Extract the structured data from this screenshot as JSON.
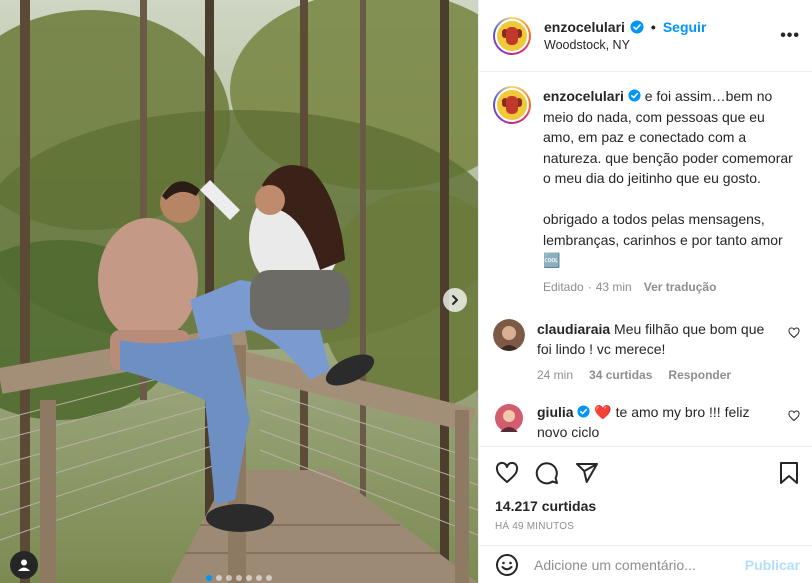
{
  "post": {
    "username": "enzocelulari",
    "follow_label": "Seguir",
    "location": "Woodstock, NY",
    "more_label": "•••"
  },
  "caption": {
    "username": "enzocelulari",
    "paragraph1": "e foi assim…bem no meio do nada, com pessoas que eu amo, em paz e conectado com a natureza. que benção poder comemorar o meu dia do jeitinho que eu gosto.",
    "paragraph2": "obrigado a todos pelas mensagens, lembranças, carinhos e por tanto amor 🆒",
    "edited": "Editado",
    "time": "43 min",
    "translate": "Ver tradução"
  },
  "comments": [
    {
      "username": "claudiaraia",
      "text": "Meu filhão que bom que foi lindo ! vc merece!",
      "time": "24 min",
      "likes": "34 curtidas",
      "reply": "Responder"
    },
    {
      "username": "giulia",
      "text": "❤️ te amo my bro !!! feliz novo ciclo"
    }
  ],
  "stats": {
    "likes": "14.217 curtidas",
    "time_ago": "HÁ 49 MINUTOS"
  },
  "composer": {
    "placeholder": "Adicione um comentário...",
    "publish_label": "Publicar"
  },
  "carousel": {
    "slides": 7,
    "active_index": 0
  },
  "icons": [
    "heart-icon",
    "comment-icon",
    "share-icon",
    "bookmark-icon",
    "emoji-icon",
    "verified-icon",
    "chevron-right-icon",
    "user-tag-icon"
  ],
  "colors": {
    "accent": "#0095f6",
    "publish_disabled": "#b2dffc",
    "muted": "#8e8e8e",
    "text": "#262626",
    "heart_red": "#ed4956"
  }
}
